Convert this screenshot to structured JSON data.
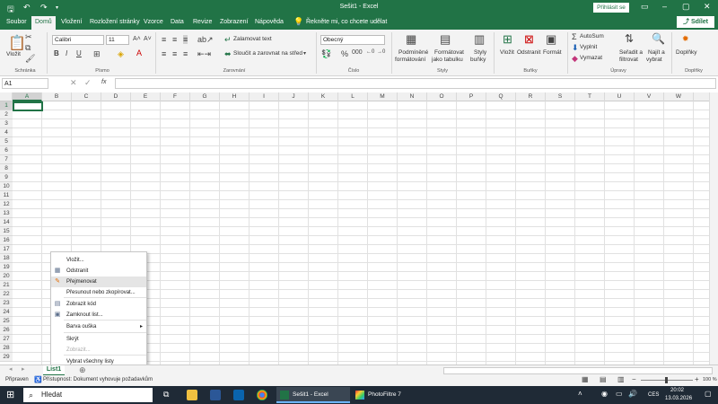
{
  "titlebar": {
    "title": "Sešit1 - Excel",
    "signin": "Přihlásit se"
  },
  "tabs": [
    "Soubor",
    "Domů",
    "Vložení",
    "Rozložení stránky",
    "Vzorce",
    "Data",
    "Revize",
    "Zobrazení",
    "Nápověda"
  ],
  "tellme": "Řekněte mi, co chcete udělat",
  "share": "Sdílet",
  "ribbon": {
    "paste": "Vložit",
    "font_name": "Calibri",
    "font_size": "11",
    "wrap_text": "Zalamovat text",
    "merge_center": "Sloučit a zarovnat na střed",
    "number_format": "Obecný",
    "conditional_1": "Podmíněné",
    "conditional_2": "formátování",
    "format_table_1": "Formátovat",
    "format_table_2": "jako tabulku",
    "styles_1": "Styly",
    "styles_2": "buňky",
    "insert": "Vložit",
    "delete": "Odstranit",
    "format": "Formát",
    "autosum": "AutoSum",
    "fill": "Vyplnit",
    "clear": "Vymazat",
    "sort_1": "Seřadit a",
    "sort_2": "filtrovat",
    "find_1": "Najít a",
    "find_2": "vybrat",
    "addins": "Doplňky",
    "groups": {
      "clipboard": "Schránka",
      "font": "Písmo",
      "alignment": "Zarovnání",
      "number": "Číslo",
      "styles": "Styly",
      "cells": "Buňky",
      "editing": "Úpravy",
      "addins": "Doplňky"
    }
  },
  "formula_bar": {
    "name_box": "A1",
    "fx": "fx",
    "value": ""
  },
  "columns": [
    "A",
    "B",
    "C",
    "D",
    "E",
    "F",
    "G",
    "H",
    "I",
    "J",
    "K",
    "L",
    "M",
    "N",
    "O",
    "P",
    "Q",
    "R",
    "S",
    "T",
    "U",
    "V",
    "W"
  ],
  "rows": [
    "1",
    "2",
    "3",
    "4",
    "5",
    "6",
    "7",
    "8",
    "9",
    "10",
    "11",
    "12",
    "13",
    "14",
    "15",
    "16",
    "17",
    "18",
    "19",
    "20",
    "21",
    "22",
    "23",
    "24",
    "25",
    "26",
    "27",
    "28",
    "29"
  ],
  "context_menu": [
    {
      "label": "Vložit...",
      "icon": "",
      "disabled": false
    },
    {
      "label": "Odstranit",
      "icon": "delete-sheet-icon",
      "disabled": false
    },
    {
      "label": "Přejmenovat",
      "icon": "rename-icon",
      "disabled": false,
      "highlight": true
    },
    {
      "label": "Přesunout nebo zkopírovat...",
      "icon": "",
      "disabled": false
    },
    {
      "label": "Zobrazit kód",
      "icon": "view-code-icon",
      "disabled": false
    },
    {
      "label": "Zamknout list...",
      "icon": "protect-sheet-icon",
      "disabled": false
    },
    {
      "label": "Barva ouška",
      "icon": "",
      "disabled": false,
      "submenu": true
    },
    {
      "label": "Skrýt",
      "icon": "",
      "disabled": false
    },
    {
      "label": "Zobrazit...",
      "icon": "",
      "disabled": true
    },
    {
      "label": "Vybrat všechny listy",
      "icon": "",
      "disabled": false
    }
  ],
  "sheet_tab": "List1",
  "status": {
    "ready": "Připraven",
    "accessibility": "Přístupnost: Dokument vyhovuje požadavkům",
    "zoom": "100 %"
  },
  "taskbar": {
    "search": "Hledat",
    "excel_app": "Sešit1 - Excel",
    "photofiltre_app": "PhotoFiltre 7",
    "lang": "CES",
    "time": "20:02",
    "date": "13.03.2026"
  }
}
